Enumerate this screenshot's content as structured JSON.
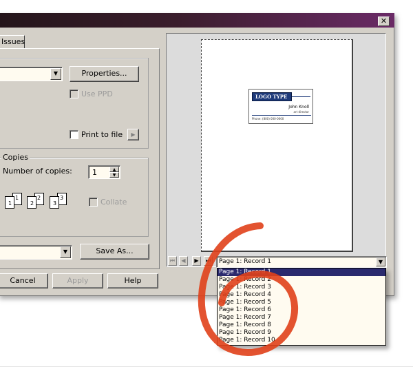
{
  "window": {
    "close_glyph": "✕"
  },
  "tabs": {
    "issues": "Issues"
  },
  "printer": {
    "properties_label": "Properties...",
    "use_ppd_label": "Use PPD",
    "print_to_file_label": "Print to file"
  },
  "copies": {
    "group_label": "Copies",
    "number_label": "Number of copies:",
    "number_value": "1",
    "collate_label": "Collate",
    "page_numbers": [
      "1",
      "1",
      "2",
      "2",
      "3",
      "3"
    ]
  },
  "save_as_label": "Save As...",
  "footer": {
    "cancel": "Cancel",
    "apply": "Apply",
    "help": "Help"
  },
  "preview": {
    "card_logo": "LOGO TYPE",
    "card_name": "John Knoll",
    "card_title": "art director",
    "card_phone": "Phone: (800) 000-0000",
    "current_record": "Page 1: Record 1",
    "records": [
      "Page 1: Record 1",
      "Page 1: Record 2",
      "Page 1: Record 3",
      "Page 1: Record 4",
      "Page 1: Record 5",
      "Page 1: Record 6",
      "Page 1: Record 7",
      "Page 1: Record 8",
      "Page 1: Record 9",
      "Page 1: Record 10"
    ]
  },
  "colors": {
    "annotation": "#e0401a",
    "title_gradient_end": "#6a2a66",
    "selected_row": "#2a2a6e"
  }
}
